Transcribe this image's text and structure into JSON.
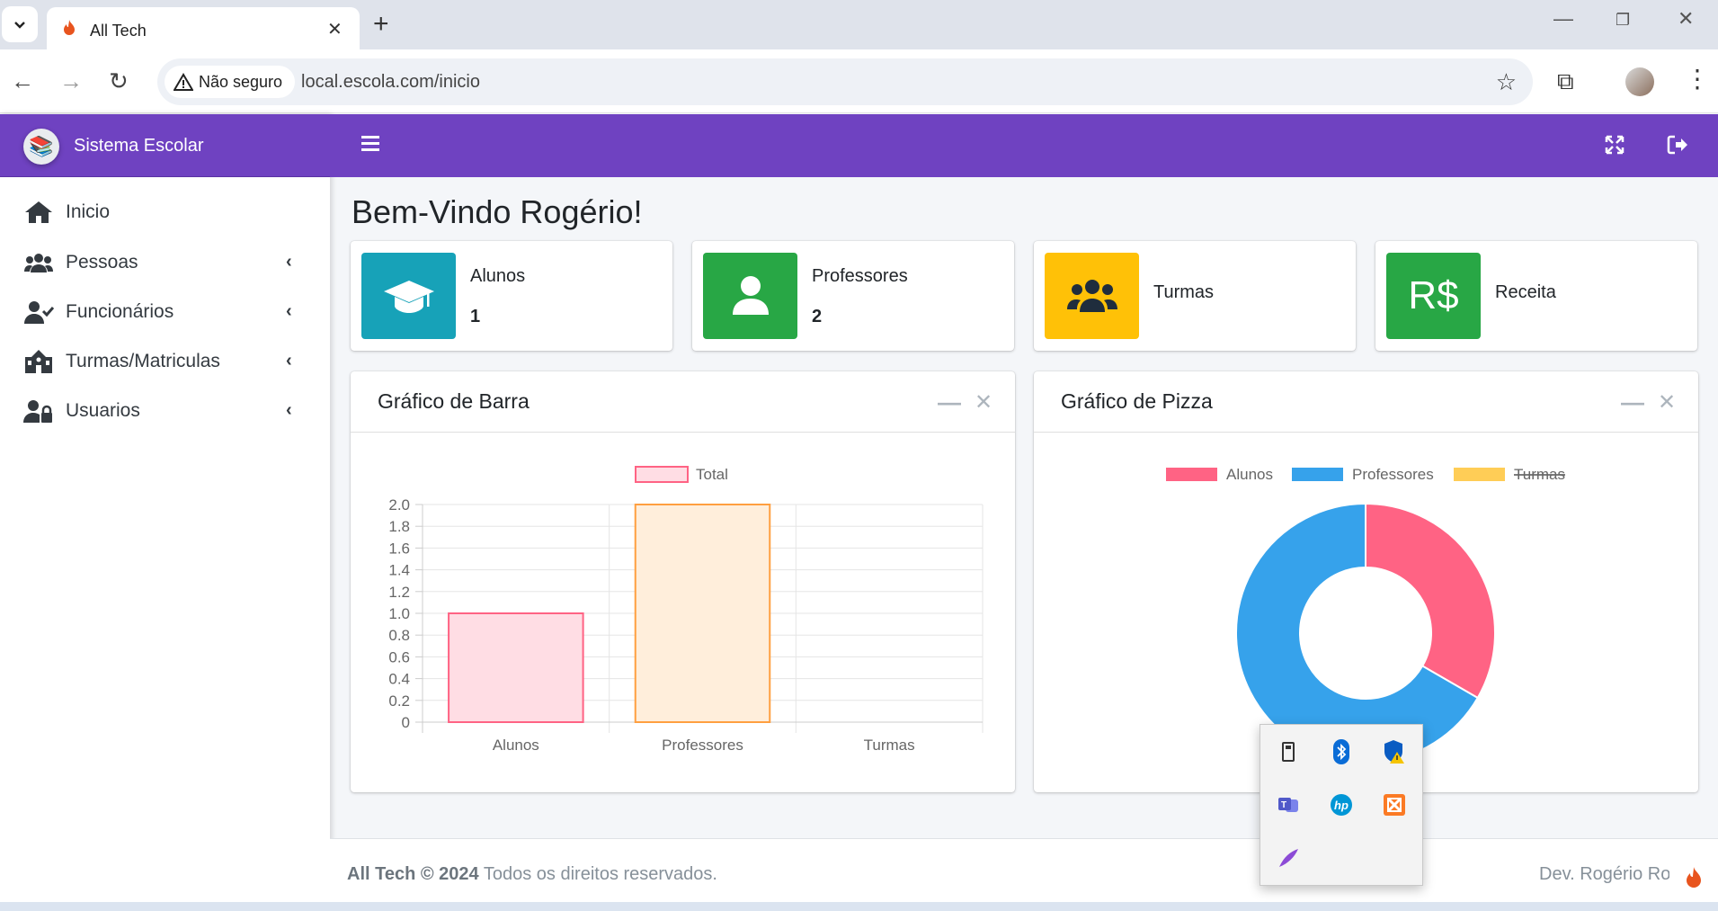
{
  "browser": {
    "tab_title": "All Tech",
    "security_label": "Não seguro",
    "url": "local.escola.com/inicio"
  },
  "sidebar": {
    "brand": "Sistema Escolar",
    "items": [
      {
        "label": "Inicio",
        "icon": "home-icon"
      },
      {
        "label": "Pessoas",
        "icon": "users-icon"
      },
      {
        "label": "Funcionários",
        "icon": "user-check-icon"
      },
      {
        "label": "Turmas/Matriculas",
        "icon": "school-icon"
      },
      {
        "label": "Usuarios",
        "icon": "user-lock-icon"
      }
    ]
  },
  "main": {
    "welcome": "Bem-Vindo Rogério!",
    "info_boxes": [
      {
        "label": "Alunos",
        "value": "1",
        "color": "#17a2b8",
        "icon": "graduation-cap-icon"
      },
      {
        "label": "Professores",
        "value": "2",
        "color": "#28a745",
        "icon": "user-icon"
      },
      {
        "label": "Turmas",
        "value": "",
        "color": "#ffc107",
        "icon": "users-icon"
      },
      {
        "label": "Receita",
        "value": "",
        "color": "#28a745",
        "icon_text": "R$"
      }
    ],
    "bar_card_title": "Gráfico de Barra",
    "pie_card_title": "Gráfico de Pizza"
  },
  "chart_data": [
    {
      "type": "bar",
      "categories": [
        "Alunos",
        "Professores",
        "Turmas"
      ],
      "series": [
        {
          "name": "Total",
          "values": [
            1,
            2,
            0
          ]
        }
      ],
      "ylim": [
        0,
        2.0
      ],
      "yticks": [
        "0",
        "0.2",
        "0.4",
        "0.6",
        "0.8",
        "1.0",
        "1.2",
        "1.4",
        "1.6",
        "1.8",
        "2.0"
      ],
      "legend": "top",
      "grid": true,
      "bar_fill_colors": [
        "#ffdde4",
        "#ffeedb",
        "#fff6dd"
      ],
      "bar_stroke_colors": [
        "#ff6384",
        "#ff9f40",
        "#ffcd56"
      ]
    },
    {
      "type": "pie",
      "variant": "doughnut",
      "labels": [
        "Alunos",
        "Professores",
        "Turmas"
      ],
      "values": [
        1,
        2,
        0
      ],
      "hidden": [
        "Turmas"
      ],
      "colors": [
        "#ff6384",
        "#36a2eb",
        "#ffcd56"
      ],
      "legend": "top"
    }
  ],
  "footer": {
    "brand_year": "All Tech © 2024",
    "rights": "Todos os direitos reservados.",
    "dev": "Dev. Rogério Ro"
  },
  "tray_icons": [
    "usb-drive-icon",
    "bluetooth-icon",
    "windows-security-icon",
    "teams-icon",
    "hp-icon",
    "xampp-icon",
    "feather-icon"
  ]
}
